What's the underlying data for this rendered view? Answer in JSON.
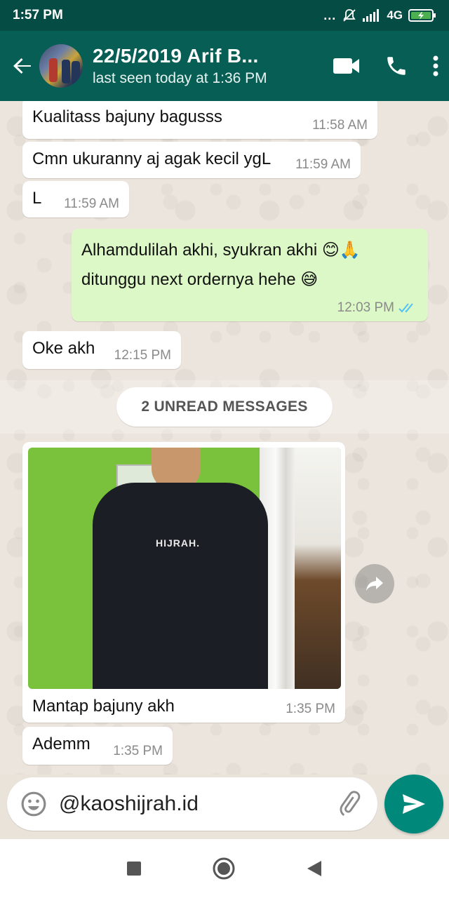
{
  "status_bar": {
    "time": "1:57 PM",
    "dots": "...",
    "network": "4G"
  },
  "header": {
    "contact_name": "22/5/2019 Arif B...",
    "last_seen": "last seen today at 1:36 PM"
  },
  "icons": {
    "back": "arrow-left-icon",
    "video": "video-call-icon",
    "call": "phone-icon",
    "more": "more-vertical-icon",
    "emoji": "emoji-icon",
    "attach": "paperclip-icon",
    "send": "send-icon",
    "forward": "forward-icon",
    "read_receipt": "double-check-icon"
  },
  "colors": {
    "header": "#075e54",
    "status_bar": "#054d44",
    "outgoing_bubble": "#dcf8c6",
    "incoming_bubble": "#ffffff",
    "send_button": "#00897b",
    "read_receipt": "#4fc3f7"
  },
  "messages": [
    {
      "direction": "in",
      "text": "Kualitass bajuny bagusss",
      "time": "11:58 AM"
    },
    {
      "direction": "in",
      "text": "Cmn ukuranny aj agak kecil ygL",
      "time": "11:59 AM"
    },
    {
      "direction": "in",
      "text": "L",
      "time": "11:59 AM"
    },
    {
      "direction": "out",
      "text_line1": "Alhamdulilah akhi, syukran akhi 😊🙏",
      "text_line2": "ditunggu next ordernya hehe 😅",
      "time": "12:03 PM"
    },
    {
      "direction": "in",
      "text": "Oke akh",
      "time": "12:15 PM"
    },
    {
      "direction": "in",
      "type": "image",
      "image_print": "HIJRAH.",
      "caption": "Mantap bajuny akh",
      "time": "1:35 PM"
    },
    {
      "direction": "in",
      "text": "Ademm",
      "time": "1:35 PM"
    }
  ],
  "unread_divider": "2 UNREAD MESSAGES",
  "composer": {
    "value": "@kaoshijrah.id"
  }
}
